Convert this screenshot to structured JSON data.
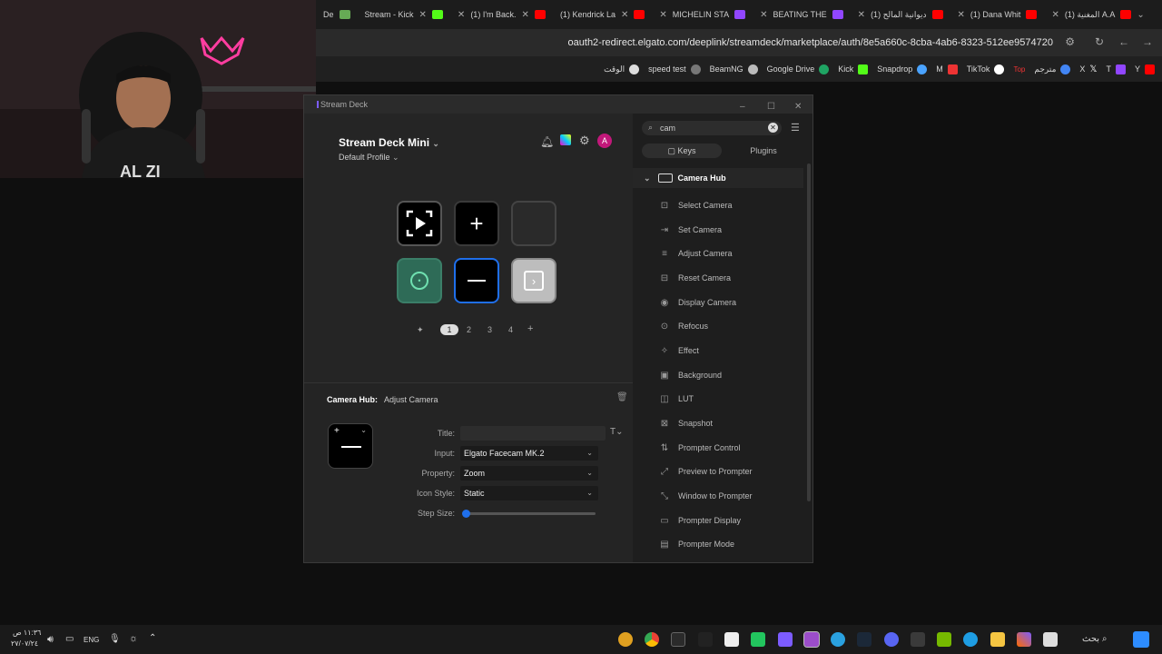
{
  "browser": {
    "tabs": [
      {
        "label": "De",
        "icon": "tab-icon",
        "color": "#555"
      },
      {
        "label": "Stream - Kick",
        "icon": "chrome-icon",
        "color": "#e05"
      },
      {
        "label": "(1) I'm Back.",
        "icon": "kick-icon",
        "color": "#53fc18"
      },
      {
        "label": "(1) Kendrick La",
        "icon": "youtube-icon",
        "color": "#f00"
      },
      {
        "label": "MICHELIN STA",
        "icon": "youtube-icon",
        "color": "#f00"
      },
      {
        "label": "BEATING THE",
        "icon": "twitch-icon",
        "color": "#9146ff"
      },
      {
        "label": "(1) ديوانية المالح",
        "icon": "twitch-icon",
        "color": "#9146ff"
      },
      {
        "label": "(1) Dana Whit",
        "icon": "youtube-icon",
        "color": "#f00"
      },
      {
        "label": "(1) المغنية A.A",
        "icon": "youtube-icon",
        "color": "#f00"
      }
    ],
    "url": "oauth2-redirect.elgato.com/deeplink/streamdeck/marketplace/auth/8e5a660c-8cba-4ab6-8323-512ee9574720",
    "bookmarks": [
      {
        "label": "الوقت",
        "color": "#ddd"
      },
      {
        "label": "speed test",
        "color": "#999"
      },
      {
        "label": "BeamNG",
        "color": "#ccc"
      },
      {
        "label": "Google Drive",
        "color": "#1fa463"
      },
      {
        "label": "Kick",
        "color": "#53fc18"
      },
      {
        "label": "Snapdrop",
        "color": "#4aa3ff"
      },
      {
        "label": "M",
        "color": "#e33"
      },
      {
        "label": "TikTok",
        "color": "#fff"
      },
      {
        "label": "مترجم",
        "color": "#4285f4"
      },
      {
        "label": "X",
        "color": "#fff"
      },
      {
        "label": "T",
        "color": "#9146ff"
      },
      {
        "label": "Y",
        "color": "#f00"
      }
    ]
  },
  "window": {
    "title": "Stream Deck"
  },
  "deck": {
    "device": "Stream Deck Mini",
    "profile": "Default Profile",
    "pages": [
      "1",
      "2",
      "3",
      "4"
    ],
    "active_page": "1"
  },
  "selected": {
    "plugin": "Camera Hub:",
    "action": "Adjust Camera",
    "fields": {
      "title_label": "Title:",
      "title_value": "",
      "input_label": "Input:",
      "input_value": "Elgato Facecam MK.2",
      "property_label": "Property:",
      "property_value": "Zoom",
      "iconstyle_label": "Icon Style:",
      "iconstyle_value": "Static",
      "stepsize_label": "Step Size:",
      "stepsize_value": 0
    }
  },
  "sidebar": {
    "search_value": "cam",
    "tabs": [
      "Keys",
      "Plugins"
    ],
    "category": "Camera Hub",
    "actions": [
      "Select Camera",
      "Set Camera",
      "Adjust Camera",
      "Reset Camera",
      "Display Camera",
      "Refocus",
      "Effect",
      "Background",
      "LUT",
      "Snapshot",
      "Prompter Control",
      "Preview to Prompter",
      "Window to Prompter",
      "Prompter Display",
      "Prompter Mode"
    ]
  },
  "taskbar": {
    "time": "١١:٣٦ ص",
    "date": "٢٧/٠٧/٢٤",
    "lang": "ENG",
    "search": "بحث"
  },
  "colors": {
    "accent": "#1f6feb",
    "green_key": "#2e6b57",
    "magenta_avatar": "#c2187a"
  }
}
